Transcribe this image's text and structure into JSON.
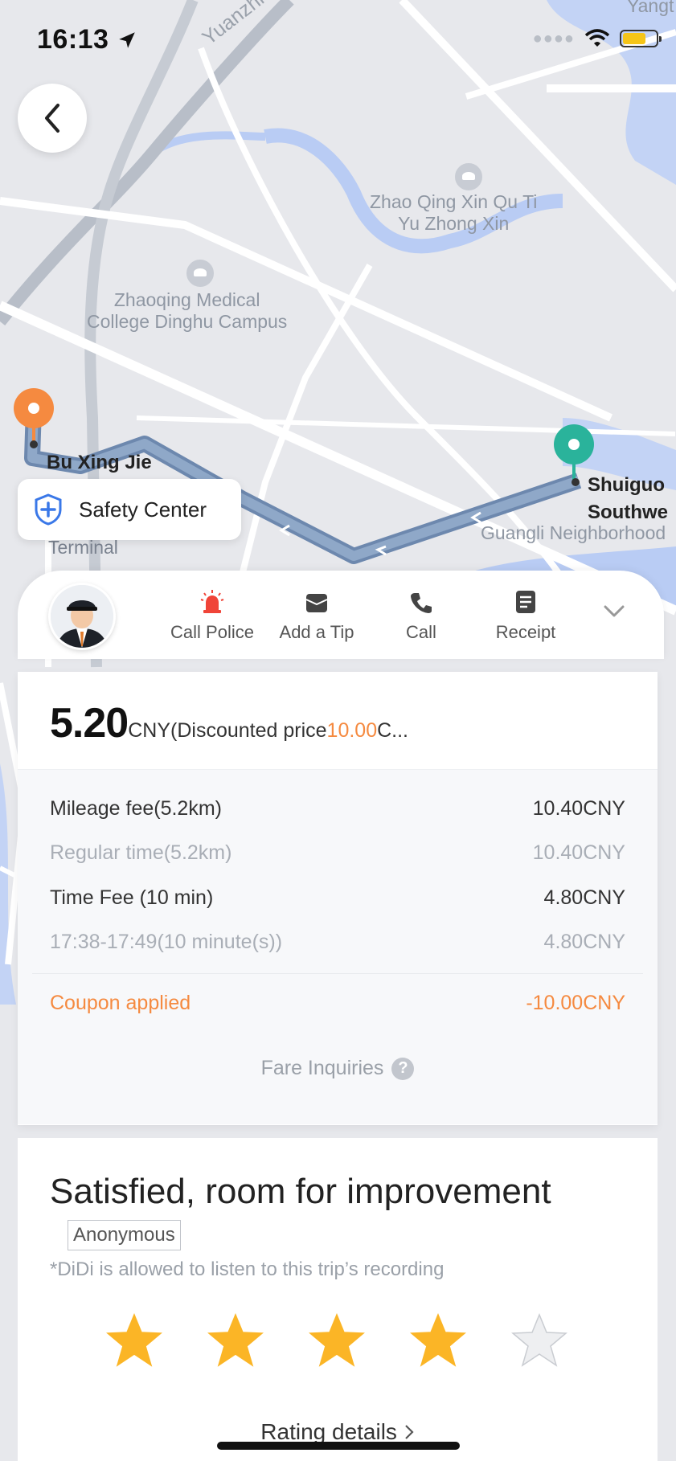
{
  "status_bar": {
    "time": "16:13",
    "battery_level": 0.7
  },
  "map": {
    "labels": {
      "yuanzhi_road": "Yuanzhi",
      "yangtai": "Yangt",
      "zhao_qing": "Zhao Qing Xin Qu Ti\nYu Zhong Xin",
      "medical_college": "Zhaoqing Medical\nCollege Dinghu Campus",
      "bu_xing_jie": "Bu Xing Jie",
      "terminal": "Terminal",
      "shuiguo": "Shuiguo",
      "southwe": "Southwe",
      "guangli": "Guangli Neighborhood"
    },
    "colors": {
      "route": "#7f98b8",
      "start_pin": "#f58a40",
      "end_pin": "#2ab39b",
      "water": "#b9ccf4"
    }
  },
  "safety_center": {
    "label": "Safety Center"
  },
  "actions": [
    {
      "label": "Call Police",
      "icon": "alarm-icon"
    },
    {
      "label": "Add a Tip",
      "icon": "envelope-icon"
    },
    {
      "label": "Call",
      "icon": "phone-icon"
    },
    {
      "label": "Receipt",
      "icon": "receipt-icon"
    }
  ],
  "fare": {
    "total": "5.20",
    "unit": "CNY",
    "discount_prefix": " (Discounted price",
    "original": "10.00",
    "suffix": "C...",
    "rows": [
      {
        "label": "Mileage fee(5.2km)",
        "value": "10.40CNY",
        "style": "main"
      },
      {
        "label": "Regular time(5.2km)",
        "value": "10.40CNY",
        "style": "sub"
      },
      {
        "label": "Time Fee (10 min)",
        "value": "4.80CNY",
        "style": "main"
      },
      {
        "label": "17:38-17:49(10 minute(s))",
        "value": "4.80CNY",
        "style": "sub"
      }
    ],
    "coupon": {
      "label": "Coupon applied",
      "value": "-10.00CNY"
    },
    "inquiries": "Fare Inquiries",
    "accent_color": "#f58a40"
  },
  "rating": {
    "title": "Satisfied, room for improvement",
    "anonymous": "Anonymous",
    "note": "*DiDi is allowed to listen to this trip’s recording",
    "stars_filled": 4,
    "stars_total": 5,
    "details": "Rating details"
  }
}
